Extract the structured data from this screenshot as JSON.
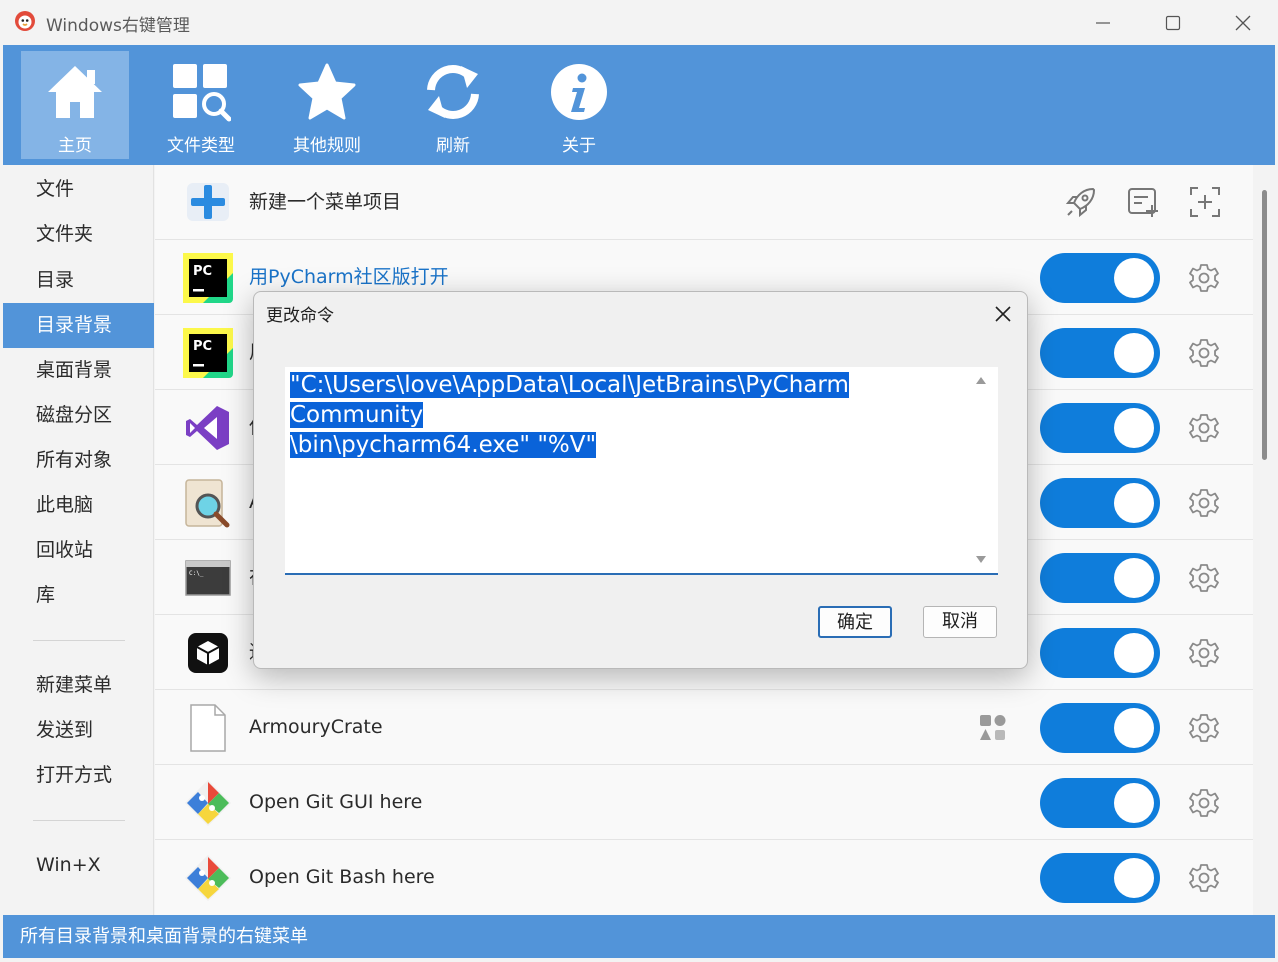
{
  "window": {
    "title": "Windows右键管理"
  },
  "toolbar": {
    "items": [
      {
        "label": "主页",
        "icon": "home-icon"
      },
      {
        "label": "文件类型",
        "icon": "file-types-icon"
      },
      {
        "label": "其他规则",
        "icon": "star-icon"
      },
      {
        "label": "刷新",
        "icon": "refresh-icon"
      },
      {
        "label": "关于",
        "icon": "info-icon"
      }
    ]
  },
  "sidebar": {
    "items": [
      "文件",
      "文件夹",
      "目录",
      "目录背景",
      "桌面背景",
      "磁盘分区",
      "所有对象",
      "此电脑",
      "回收站",
      "库"
    ],
    "items2": [
      "新建菜单",
      "发送到",
      "打开方式"
    ],
    "items3": [
      "Win+X"
    ],
    "active": "目录背景"
  },
  "list": {
    "new_item": {
      "label": "新建一个菜单项目"
    },
    "rows": [
      {
        "label": "用PyCharm社区版打开",
        "icon": "pycharm-icon",
        "enabled": true
      },
      {
        "label": "用",
        "icon": "pycharm-icon",
        "enabled": true
      },
      {
        "label": "使",
        "icon": "visual-studio-icon",
        "enabled": true
      },
      {
        "label": "A",
        "icon": "search-doc-icon",
        "enabled": true
      },
      {
        "label": "在",
        "icon": "terminal-icon",
        "enabled": true
      },
      {
        "label": "通",
        "icon": "cube-app-icon",
        "enabled": true
      },
      {
        "label": "ArmouryCrate",
        "icon": "blank-file-icon",
        "enabled": true
      },
      {
        "label": "Open Git GUI here",
        "icon": "git-icon",
        "enabled": true
      },
      {
        "label": "Open Git Bash here",
        "icon": "git-icon",
        "enabled": true
      }
    ]
  },
  "statusbar": {
    "text": "所有目录背景和桌面背景的右键菜单"
  },
  "dialog": {
    "title": "更改命令",
    "command_line1": "\"C:\\Users\\love\\AppData\\Local\\JetBrains\\PyCharm Community",
    "command_line2": "\\bin\\pycharm64.exe\" \"%V\"",
    "ok_label": "确定",
    "cancel_label": "取消"
  },
  "colors": {
    "accent": "#5294d9",
    "toggle_on": "#0f7ddb",
    "link": "#1a73c8",
    "selection": "#0a63d9"
  }
}
